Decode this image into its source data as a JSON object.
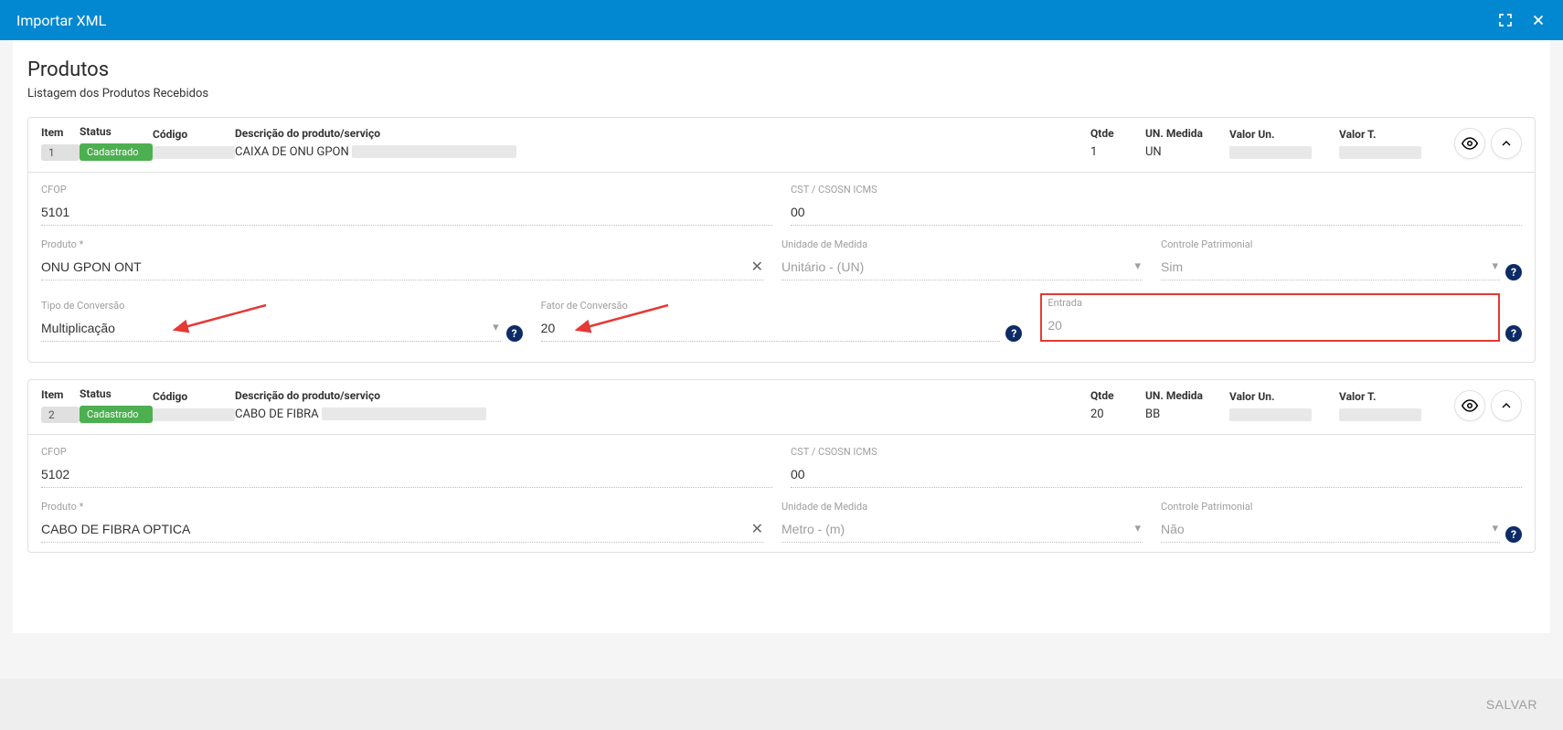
{
  "header": {
    "title": "Importar XML"
  },
  "section": {
    "title": "Produtos",
    "subtitle": "Listagem dos Produtos Recebidos"
  },
  "headers": {
    "item": "Item",
    "status": "Status",
    "codigo": "Código",
    "descricao": "Descrição do produto/serviço",
    "qtde": "Qtde",
    "un_medida": "UN. Medida",
    "valor_un": "Valor Un.",
    "valor_t": "Valor T."
  },
  "labels": {
    "cfop": "CFOP",
    "cst": "CST / CSOSN ICMS",
    "produto": "Produto *",
    "unidade": "Unidade de Medida",
    "controle": "Controle Patrimonial",
    "tipo_conv": "Tipo de Conversão",
    "fator_conv": "Fator de Conversão",
    "entrada": "Entrada"
  },
  "products": [
    {
      "item": "1",
      "status": "Cadastrado",
      "descricao": "CAIXA DE ONU GPON",
      "qtde": "1",
      "un_medida": "UN",
      "cfop": "5101",
      "cst": "00",
      "produto": "ONU GPON ONT",
      "unidade": "Unitário - (UN)",
      "controle": "Sim",
      "tipo_conv": "Multiplicação",
      "fator_conv": "20",
      "entrada": "20"
    },
    {
      "item": "2",
      "status": "Cadastrado",
      "descricao": "CABO DE FIBRA",
      "qtde": "20",
      "un_medida": "BB",
      "cfop": "5102",
      "cst": "00",
      "produto": "CABO DE FIBRA OPTICA",
      "unidade": "Metro - (m)",
      "controle": "Não"
    }
  ],
  "footer": {
    "save": "SALVAR"
  }
}
